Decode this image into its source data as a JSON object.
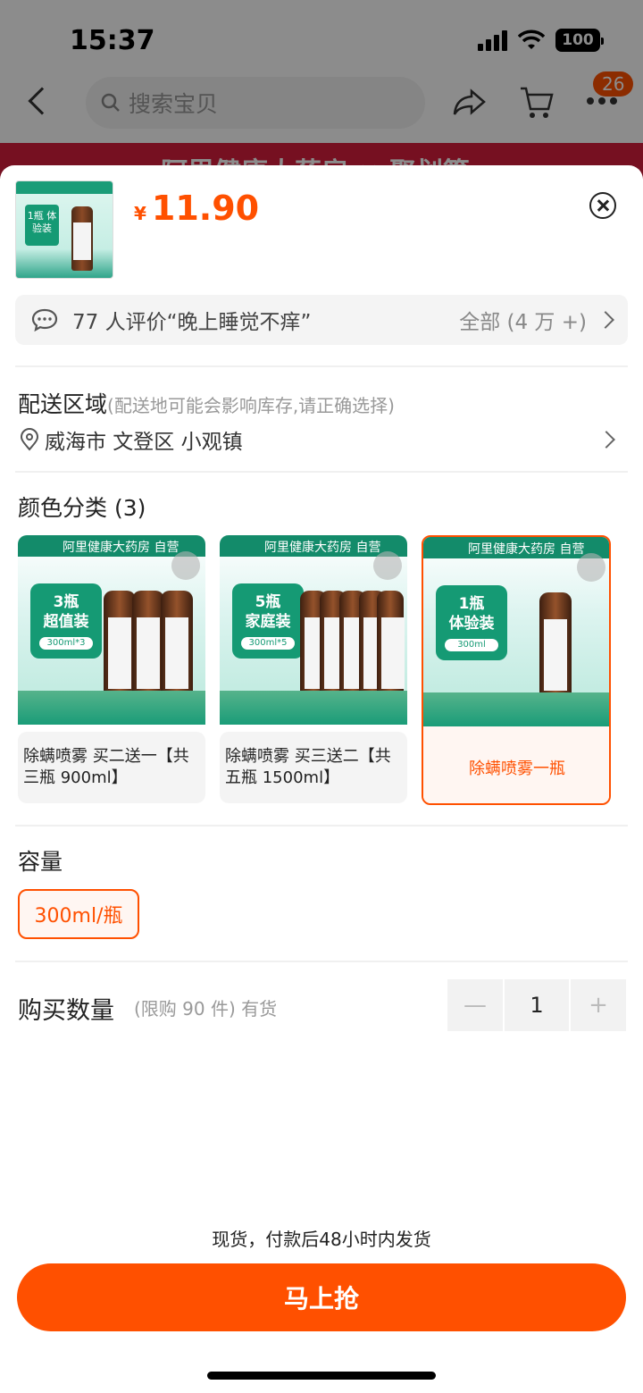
{
  "status_bar": {
    "time": "15:37",
    "battery": "100"
  },
  "nav": {
    "search_placeholder": "搜索宝贝",
    "cart_badge": "26"
  },
  "banner": {
    "text": "阿里健康大药房 × 聚划算"
  },
  "product": {
    "currency": "¥",
    "price": "11.90",
    "thumb_tag": "1瓶 体验装"
  },
  "review": {
    "text": "77 人评价“晚上睡觉不痒”",
    "all_label": "全部 (4 万 +)"
  },
  "delivery": {
    "title": "配送区域",
    "note": "(配送地可能会影响库存,请正确选择)",
    "address": "威海市 文登区 小观镇"
  },
  "color_section": {
    "title": "颜色分类 (3)",
    "store_label": "阿里健康大药房",
    "store_badge": "自营",
    "options": [
      {
        "tag_line1": "3瓶",
        "tag_line2": "超值装",
        "tag_sub": "300ml*3",
        "caption": "除螨喷雾  买二送一【共三瓶 900ml】",
        "selected": false
      },
      {
        "tag_line1": "5瓶",
        "tag_line2": "家庭装",
        "tag_sub": "300ml*5",
        "caption": "除螨喷雾  买三送二【共五瓶 1500ml】",
        "selected": false
      },
      {
        "tag_line1": "1瓶",
        "tag_line2": "体验装",
        "tag_sub": "300ml",
        "caption": "除螨喷雾一瓶",
        "selected": true
      }
    ]
  },
  "capacity": {
    "title": "容量",
    "option": "300ml/瓶"
  },
  "quantity": {
    "title": "购买数量",
    "note": "(限购 90 件) 有货",
    "minus": "—",
    "value": "1",
    "plus": "+"
  },
  "shipping_note": "现货，付款后48小时内发货",
  "buy_button": "马上抢",
  "colors": {
    "accent": "#ff5000",
    "brand_green": "#159a74"
  }
}
